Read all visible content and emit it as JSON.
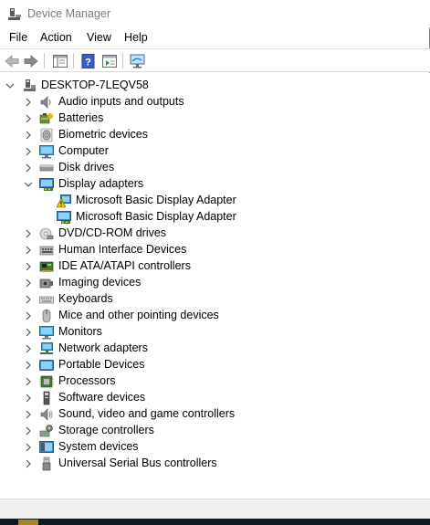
{
  "window": {
    "title": "Device Manager"
  },
  "menu": [
    "File",
    "Action",
    "View",
    "Help"
  ],
  "toolbar": {
    "buttons": [
      {
        "name": "back-arrow-icon"
      },
      {
        "name": "forward-arrow-icon"
      },
      {
        "name": "show-hide-console-tree-icon"
      },
      {
        "name": "help-icon"
      },
      {
        "name": "properties-icon"
      },
      {
        "name": "monitor-scan-icon"
      }
    ]
  },
  "tree": {
    "root": "DESKTOP-7LEQV58",
    "categories": [
      {
        "label": "Audio inputs and outputs",
        "icon": "speaker-icon",
        "expanded": false
      },
      {
        "label": "Batteries",
        "icon": "battery-icon",
        "expanded": false
      },
      {
        "label": "Biometric devices",
        "icon": "fingerprint-icon",
        "expanded": false
      },
      {
        "label": "Computer",
        "icon": "computer-icon",
        "expanded": false
      },
      {
        "label": "Disk drives",
        "icon": "disk-drive-icon",
        "expanded": false
      },
      {
        "label": "Display adapters",
        "icon": "display-adapter-icon",
        "expanded": true,
        "children": [
          {
            "label": "Microsoft Basic Display Adapter",
            "icon": "warning-display-adapter-icon"
          },
          {
            "label": "Microsoft Basic Display Adapter",
            "icon": "display-adapter-icon"
          }
        ]
      },
      {
        "label": "DVD/CD-ROM drives",
        "icon": "dvd-drive-icon",
        "expanded": false
      },
      {
        "label": "Human Interface Devices",
        "icon": "hid-icon",
        "expanded": false
      },
      {
        "label": "IDE ATA/ATAPI controllers",
        "icon": "ide-controller-icon",
        "expanded": false
      },
      {
        "label": "Imaging devices",
        "icon": "camera-icon",
        "expanded": false
      },
      {
        "label": "Keyboards",
        "icon": "keyboard-icon",
        "expanded": false
      },
      {
        "label": "Mice and other pointing devices",
        "icon": "mouse-icon",
        "expanded": false
      },
      {
        "label": "Monitors",
        "icon": "monitor-icon",
        "expanded": false
      },
      {
        "label": "Network adapters",
        "icon": "network-adapter-icon",
        "expanded": false
      },
      {
        "label": "Portable Devices",
        "icon": "portable-device-icon",
        "expanded": false
      },
      {
        "label": "Processors",
        "icon": "processor-icon",
        "expanded": false
      },
      {
        "label": "Software devices",
        "icon": "software-device-icon",
        "expanded": false
      },
      {
        "label": "Sound, video and game controllers",
        "icon": "sound-icon",
        "expanded": false
      },
      {
        "label": "Storage controllers",
        "icon": "storage-controller-icon",
        "expanded": false
      },
      {
        "label": "System devices",
        "icon": "system-device-icon",
        "expanded": false
      },
      {
        "label": "Universal Serial Bus controllers",
        "icon": "usb-icon",
        "expanded": false
      }
    ]
  },
  "colors": {
    "accent": "#1e73c8",
    "title_text": "#7a7a7a",
    "warning": "#f2c200"
  }
}
